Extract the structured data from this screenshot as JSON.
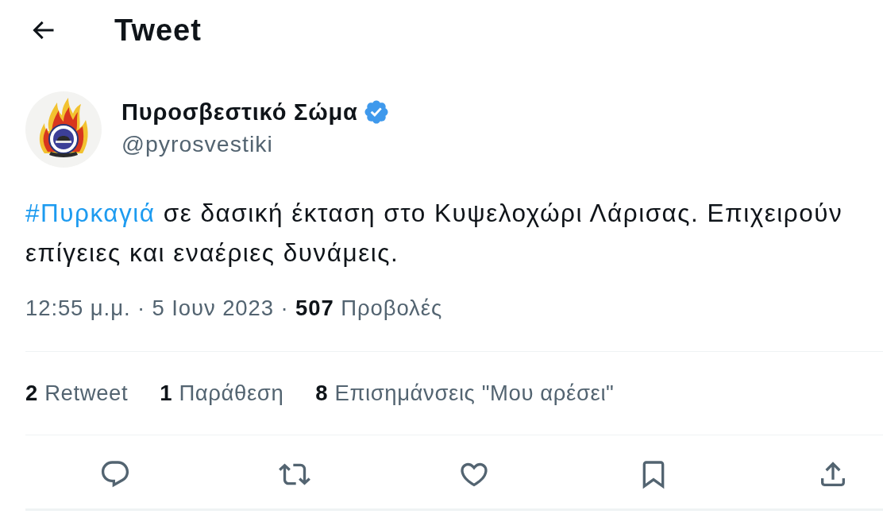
{
  "header": {
    "title": "Tweet"
  },
  "author": {
    "name": "Πυροσβεστικό Σώμα",
    "verified": true,
    "handle": "@pyrosvestiki"
  },
  "tweet": {
    "segments": [
      {
        "kind": "hashtag",
        "text": "#Πυρκαγιά"
      },
      {
        "kind": "plain",
        "text": " σε δασική έκταση στο Κυψελοχώρι Λάρισας. Επιχειρούν επίγειες και εναέριες δυνάμεις."
      }
    ]
  },
  "meta": "12:55 μ.μ. · 5 Ιουν 2023 · **507** Προβολές",
  "stats": [
    {
      "count": "2",
      "label": "Retweet"
    },
    {
      "count": "1",
      "label": "Παράθεση"
    },
    {
      "count": "8",
      "label": "Επισημάνσεις \"Μου αρέσει\""
    }
  ]
}
